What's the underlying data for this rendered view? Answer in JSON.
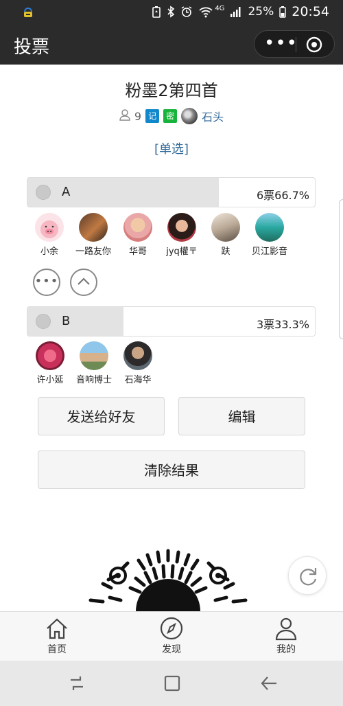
{
  "status_bar": {
    "network": "4G",
    "battery": "25%",
    "time": "20:54"
  },
  "header": {
    "title": "投票",
    "more_icon": "more-dots-icon",
    "close_icon": "target-icon"
  },
  "poll": {
    "title": "粉墨2第四首",
    "participants": "9",
    "tags": [
      "记",
      "密"
    ],
    "creator": "石头",
    "mode": "[单选]"
  },
  "options": [
    {
      "label": "A",
      "stat": "6票66.7%",
      "fraction": 0.667,
      "voters": [
        "小余",
        "一路友你",
        "华哥",
        "jyq權〒",
        "趺",
        "贝江影音"
      ]
    },
    {
      "label": "B",
      "stat": "3票33.3%",
      "fraction": 0.333,
      "voters": [
        "许小延",
        "音响博士",
        "石海华"
      ]
    }
  ],
  "actions": {
    "send": "发送给好友",
    "edit": "编辑",
    "clear": "清除结果"
  },
  "tabs": [
    "首页",
    "发现",
    "我的"
  ]
}
